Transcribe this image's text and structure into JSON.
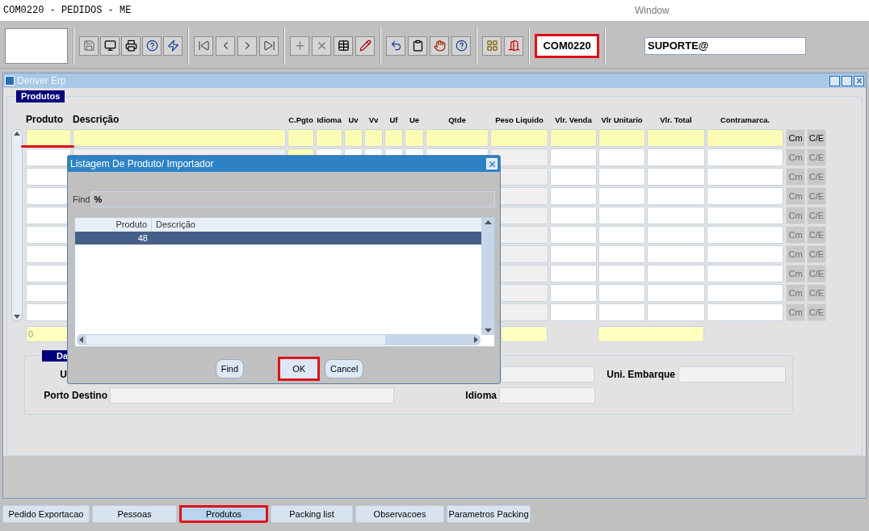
{
  "app_title": "COM0220 - PEDIDOS - ME",
  "menu": [
    "Window"
  ],
  "form_code": {
    "text": "COM0220",
    "annotated": true
  },
  "user": "SUPORTE@",
  "window": {
    "title": "Denver Erp"
  },
  "section_label": "Produtos",
  "grid": {
    "columns": [
      {
        "label": "Produto",
        "kind": "main",
        "shaded": false,
        "required": false,
        "annotated": true
      },
      {
        "label": "Descrição",
        "kind": "main",
        "shaded": true,
        "required": false
      },
      {
        "label": "C.Pgto",
        "kind": "small",
        "shaded": false,
        "required": true
      },
      {
        "label": "Idioma",
        "kind": "small",
        "shaded": false,
        "required": false
      },
      {
        "label": "Uv",
        "kind": "small",
        "shaded": false,
        "required": false
      },
      {
        "label": "Vv",
        "kind": "small",
        "shaded": false,
        "required": false
      },
      {
        "label": "Uf",
        "kind": "small",
        "shaded": false,
        "required": false
      },
      {
        "label": "Ue",
        "kind": "small",
        "shaded": false,
        "required": false
      },
      {
        "label": "Qtde",
        "kind": "small",
        "shaded": false,
        "required": false
      },
      {
        "label": "Peso Liquido",
        "kind": "small",
        "shaded": true,
        "required": false
      },
      {
        "label": "Vlr. Venda",
        "kind": "small",
        "shaded": false,
        "required": false
      },
      {
        "label": "Vlr Unitario",
        "kind": "small",
        "shaded": false,
        "required": false
      },
      {
        "label": "Vlr. Total",
        "kind": "small",
        "shaded": false,
        "required": false
      },
      {
        "label": "Contramarca.",
        "kind": "small",
        "shaded": false,
        "required": false
      }
    ],
    "rows": [
      {
        "current": true,
        "buttons": [
          {
            "label": "Cm",
            "disabled": false
          },
          {
            "label": "C/E",
            "disabled": false
          }
        ]
      },
      {
        "current": false,
        "buttons": [
          {
            "label": "Cm",
            "disabled": true
          },
          {
            "label": "C/E",
            "disabled": true
          }
        ]
      },
      {
        "current": false,
        "buttons": [
          {
            "label": "Cm",
            "disabled": true
          },
          {
            "label": "C/E",
            "disabled": true
          }
        ]
      },
      {
        "current": false,
        "buttons": [
          {
            "label": "Cm",
            "disabled": true
          },
          {
            "label": "C/E",
            "disabled": true
          }
        ]
      },
      {
        "current": false,
        "buttons": [
          {
            "label": "Cm",
            "disabled": true
          },
          {
            "label": "C/E",
            "disabled": true
          }
        ]
      },
      {
        "current": false,
        "buttons": [
          {
            "label": "Cm",
            "disabled": true
          },
          {
            "label": "C/E",
            "disabled": true
          }
        ]
      },
      {
        "current": false,
        "buttons": [
          {
            "label": "Cm",
            "disabled": true
          },
          {
            "label": "C/E",
            "disabled": true
          }
        ]
      },
      {
        "current": false,
        "buttons": [
          {
            "label": "Cm",
            "disabled": true
          },
          {
            "label": "C/E",
            "disabled": true
          }
        ]
      },
      {
        "current": false,
        "buttons": [
          {
            "label": "Cm",
            "disabled": true
          },
          {
            "label": "C/E",
            "disabled": true
          }
        ]
      },
      {
        "current": false,
        "buttons": [
          {
            "label": "Cm",
            "disabled": true
          },
          {
            "label": "C/E",
            "disabled": true
          }
        ]
      }
    ]
  },
  "totals": {
    "first": "0"
  },
  "details": {
    "title": "Da",
    "row1_label": "U",
    "uni_embarque": "Uni. Embarque",
    "porto_destino": "Porto Destino",
    "idioma": "Idioma"
  },
  "dialog": {
    "title": "Listagem De Produto/ Importador",
    "find_label": "Find",
    "find_value": "%",
    "columns": [
      "Produto",
      "Descrição"
    ],
    "rows": [
      {
        "produto": "48",
        "selected": true
      }
    ],
    "buttons": [
      {
        "label": "Find",
        "annotated": false
      },
      {
        "label": "OK",
        "annotated": true
      },
      {
        "label": "Cancel",
        "annotated": false
      }
    ]
  },
  "tabs": [
    {
      "label": "Pedido Exportacao",
      "selected": false,
      "annotated": false
    },
    {
      "label": "Pessoas",
      "selected": false,
      "annotated": false
    },
    {
      "label": "Produtos",
      "selected": true,
      "annotated": true
    },
    {
      "label": "Packing list",
      "selected": false,
      "annotated": false
    },
    {
      "label": "Observacoes",
      "selected": false,
      "annotated": false
    },
    {
      "label": "Parametros Packing",
      "selected": false,
      "annotated": false
    }
  ]
}
